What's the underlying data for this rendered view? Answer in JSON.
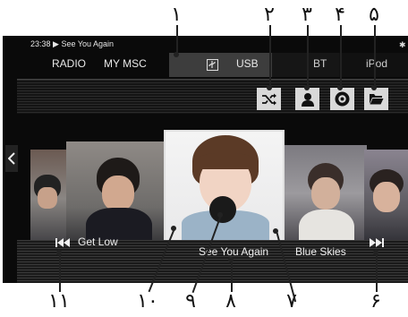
{
  "callouts": [
    "١",
    "٢",
    "٣",
    "۴",
    "۵",
    "۶",
    "٧",
    "٨",
    "٩",
    "١٠",
    "١١"
  ],
  "status": {
    "time": "23:38",
    "play_glyph": "▶",
    "title": "See You Again"
  },
  "tabs": {
    "radio": "RADIO",
    "my_msc": "MY MSC",
    "usb": "USB",
    "bt": "BT",
    "ipod": "iPod"
  },
  "bluetooth_glyph": "✱",
  "tracks": {
    "prev": "Get Low",
    "current": "See You Again",
    "next": "Blue Skies"
  },
  "icons": [
    "shuffle-icon",
    "user-icon",
    "disc-icon",
    "folder-icon",
    "prev-track-icon",
    "next-track-icon",
    "usb-icon",
    "left-arrow-icon"
  ],
  "colors": {
    "screen_bg": "#0a0a0a",
    "button_bg": "#d9d9d9",
    "tab_active_bg": "#3d3d3d"
  }
}
